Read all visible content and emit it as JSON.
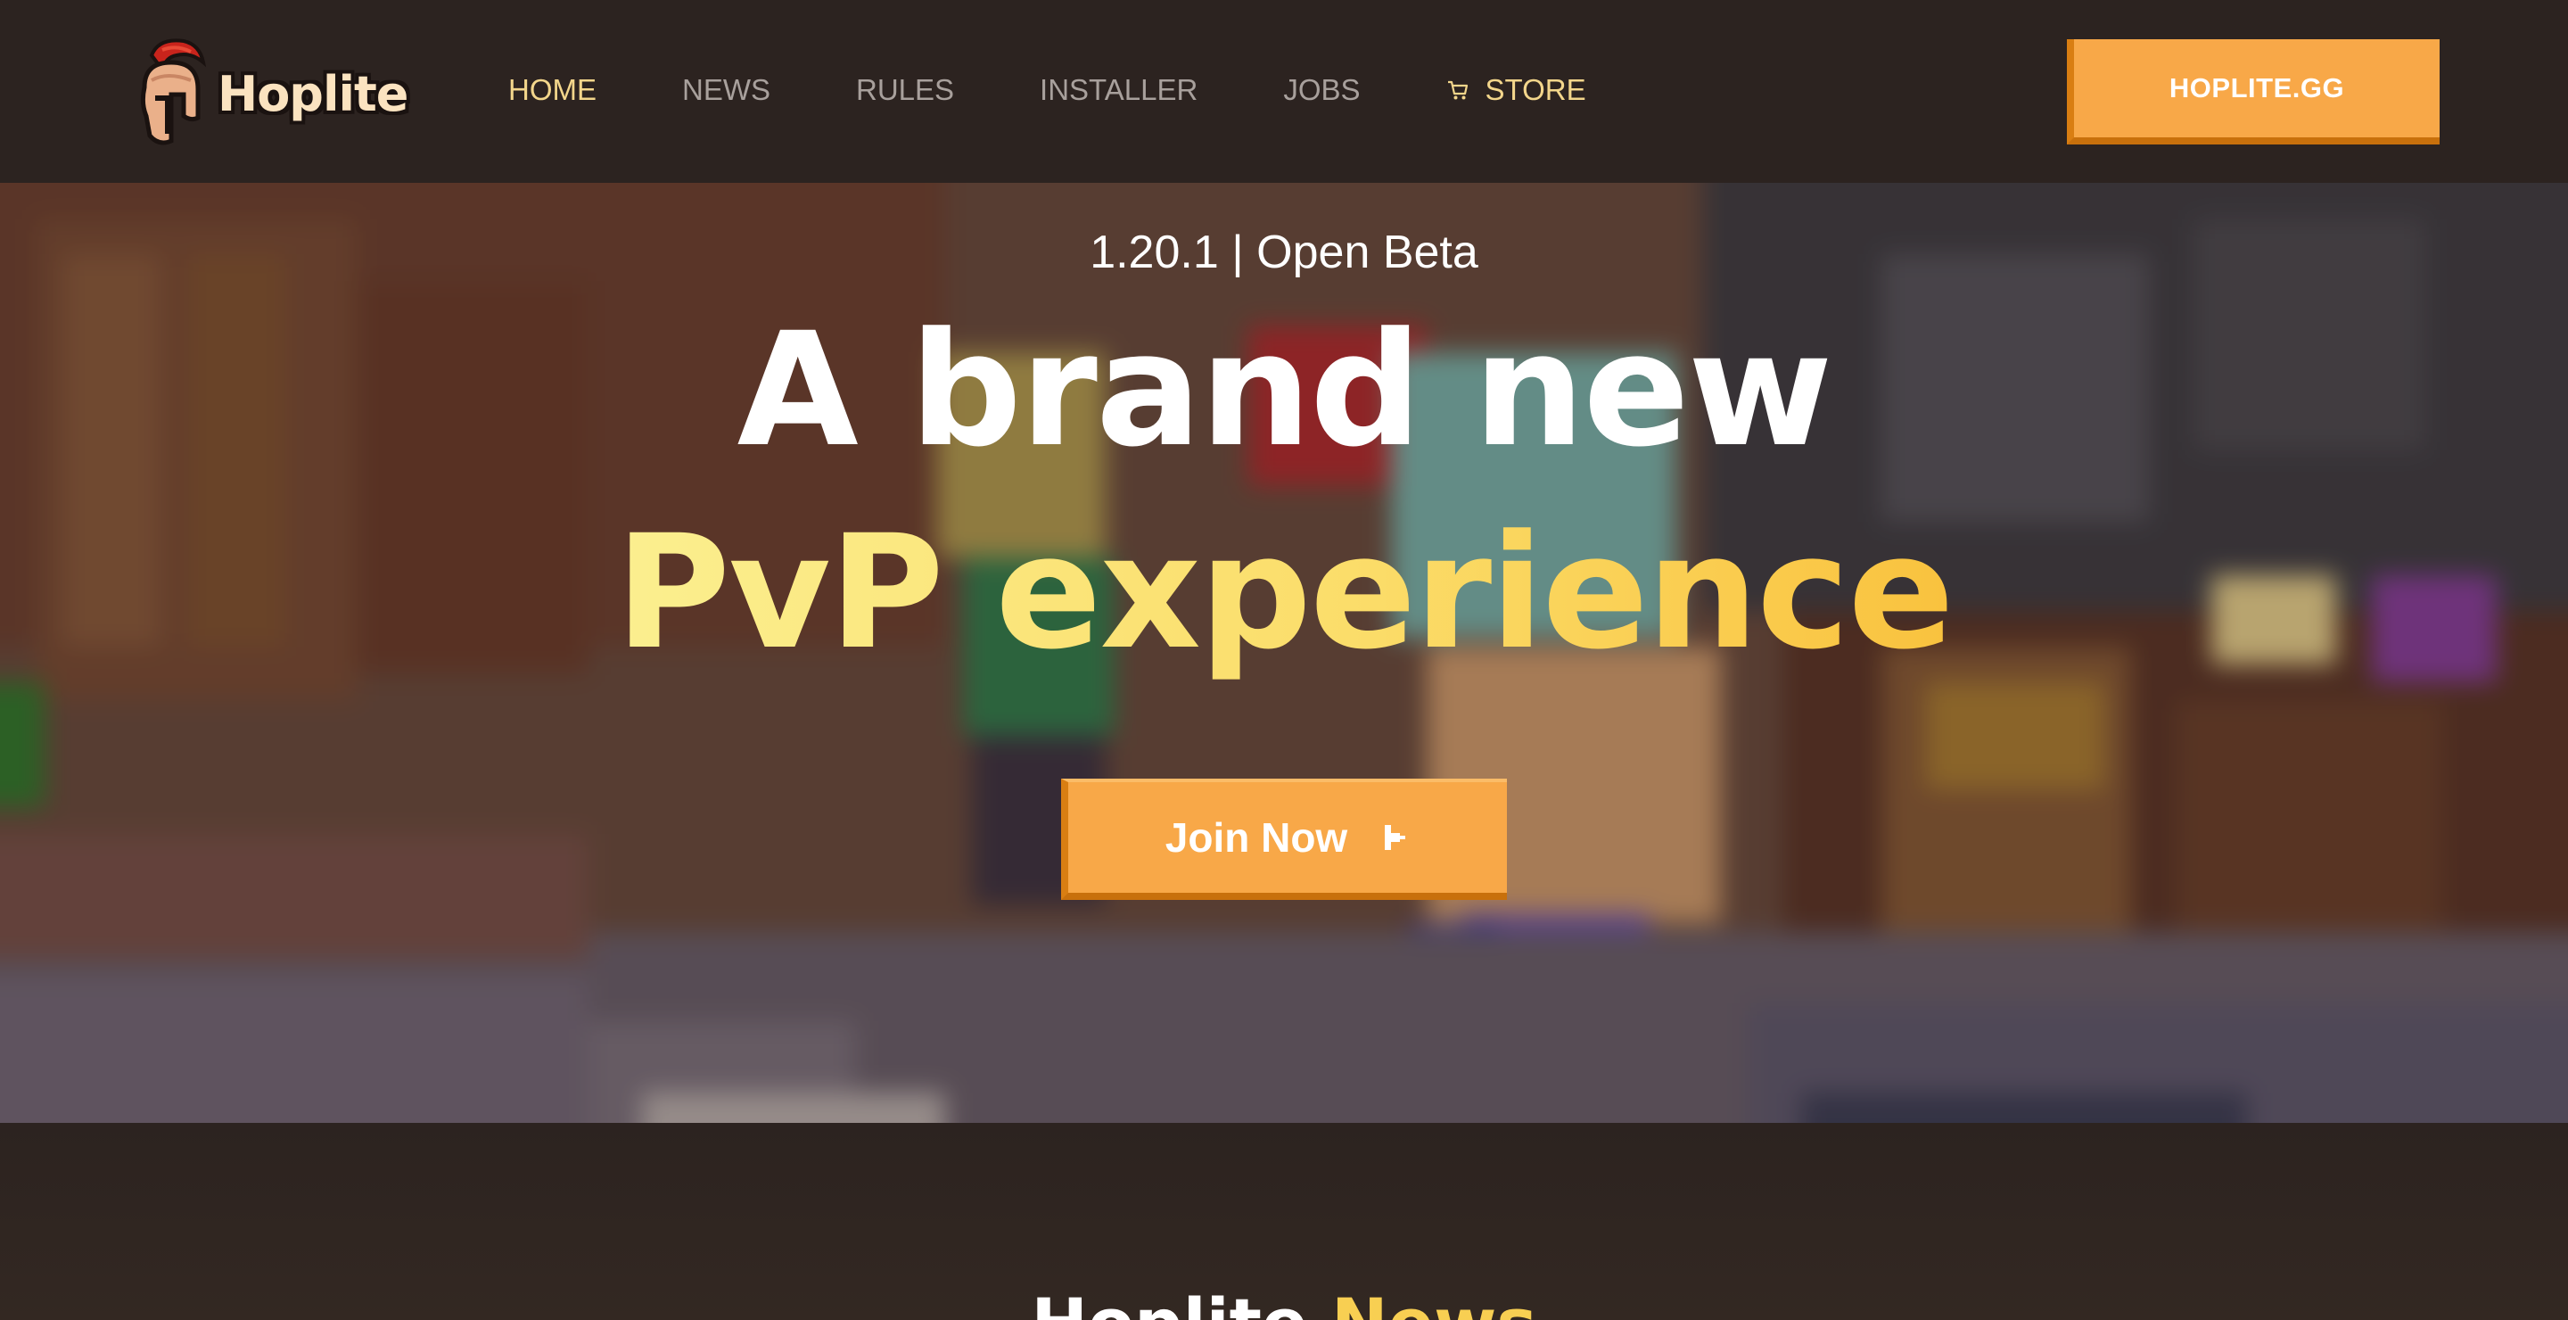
{
  "brand": {
    "name": "Hoplite"
  },
  "nav": {
    "items": [
      {
        "label": "HOME",
        "active": true
      },
      {
        "label": "NEWS",
        "active": false
      },
      {
        "label": "RULES",
        "active": false
      },
      {
        "label": "INSTALLER",
        "active": false
      },
      {
        "label": "JOBS",
        "active": false
      },
      {
        "label": "STORE",
        "active": false,
        "icon": "cart-icon"
      }
    ],
    "cta_label": "HOPLITE.GG"
  },
  "hero": {
    "version": "1.20.1 | Open Beta",
    "headline_line1": "A brand new",
    "headline_line2": "PvP experience",
    "join_label": "Join Now",
    "join_icon": "enter-icon"
  },
  "news": {
    "title_part1": "Hoplite",
    "title_part2": "News"
  },
  "colors": {
    "background": "#2c2320",
    "accent": "#f8a848",
    "accent_dark": "#d97e12",
    "highlight": "#f3d68b",
    "gold_gradient_start": "#fbef8f",
    "gold_gradient_end": "#f9c23e"
  }
}
